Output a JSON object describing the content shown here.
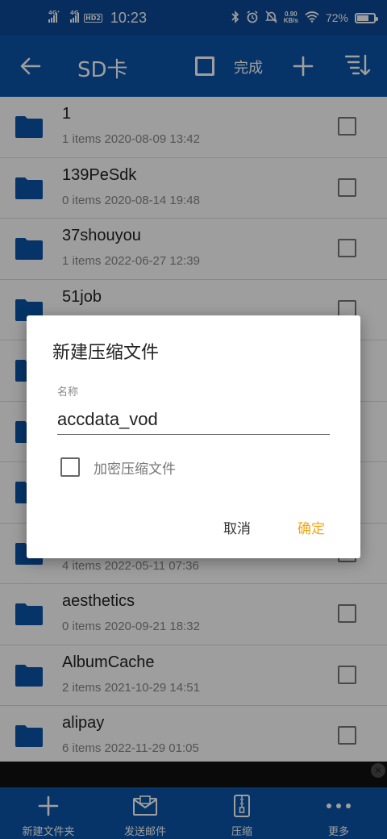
{
  "status_bar": {
    "signal1": "4G⁺",
    "signal2": "4G",
    "hd": "HD2",
    "time": "10:23",
    "speed_value": "0.90",
    "speed_unit": "KB/s",
    "battery": "72%",
    "battery_level": 0.72
  },
  "app_bar": {
    "title": "SD卡",
    "done_label": "完成"
  },
  "files": [
    {
      "name": "1",
      "meta": "1 items 2020-08-09 13:42"
    },
    {
      "name": "139PeSdk",
      "meta": "0 items 2020-08-14 19:48"
    },
    {
      "name": "37shouyou",
      "meta": "1 items 2022-06-27 12:39"
    },
    {
      "name": "51job",
      "meta": ""
    },
    {
      "name": "",
      "meta": ""
    },
    {
      "name": "",
      "meta": ""
    },
    {
      "name": "",
      "meta": ""
    },
    {
      "name": "",
      "meta": "4 items 2022-05-11 07:36"
    },
    {
      "name": "aesthetics",
      "meta": "0 items 2020-09-21 18:32"
    },
    {
      "name": "AlbumCache",
      "meta": "2 items 2021-10-29 14:51"
    },
    {
      "name": "alipay",
      "meta": "6 items 2022-11-29 01:05"
    }
  ],
  "bottom_bar": {
    "new_folder": "新建文件夹",
    "send_mail": "发送邮件",
    "compress": "压缩",
    "more": "更多"
  },
  "dialog": {
    "title": "新建压缩文件",
    "field_label": "名称",
    "name_value": "accdata_vod",
    "encrypt_label": "加密压缩文件",
    "cancel_label": "取消",
    "ok_label": "确定"
  },
  "colors": {
    "app_bar": "#0a55a8",
    "status_bar": "#0a4a96",
    "folder": "#0a55a8",
    "accent": "#f2a615"
  }
}
